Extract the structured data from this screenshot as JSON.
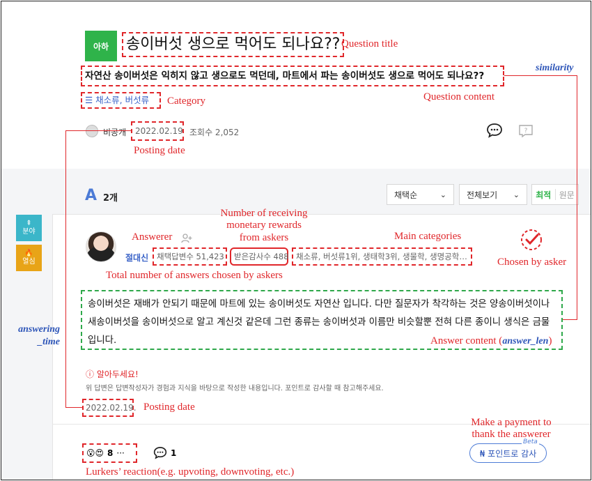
{
  "question": {
    "badge": "아하",
    "title": "송이버섯 생으로 먹어도 되나요??",
    "content": "자연산 송이버섯은 익히지 않고 생으로도 먹던데, 마트에서 파는 송이버섯도 생으로 먹어도 되나요??",
    "category": "☰ 채소류, 버섯류",
    "author": "비공개",
    "date": "2022.02.19",
    "views": "조회수 2,052"
  },
  "answers_header": {
    "count_icon": "A",
    "count": "2개",
    "sort_select": "채택순",
    "view_select": "전체보기",
    "tab_latest": "최적",
    "tab_original": "원문"
  },
  "side_buttons": [
    {
      "icon": "⇞",
      "label": "분야",
      "color": "#3bb6c9"
    },
    {
      "icon": "🔥",
      "label": "열심",
      "color": "#e8a417"
    }
  ],
  "answer": {
    "name": "절대신",
    "chosen_count": "채택답변수 51,423",
    "rewards": "받은감사수 488",
    "main_categories": "채소류, 버섯류1위, 생태학3위, 생물학, 생명공학…",
    "content": "송이버섯은 재배가 안되기 때문에 마트에 있는 송이버섯도 자연산 입니다. 다만 질문자가 착각하는 것은 양송이버섯이나 새송이버섯을 송이버섯으로 알고 계신것 같은데 그런 종류는 송이버섯과 이름만 비슷할뿐 전혀 다른 종이니 생식은 금물입니다.",
    "notice_title": "ⓘ 알아두세요!",
    "notice_body": "위 답변은 답변작성자가 경험과 지식을 바탕으로 작성한 내용입니다. 포인트로 감사할 때 참고해주세요.",
    "date": "2022.02.19.",
    "reaction_emoji": "😮😍",
    "reaction_count": "8",
    "reaction_more": "···",
    "comment_count": "1",
    "pay_button": "₦ 포인트로 감사",
    "pay_beta": "Beta"
  },
  "annotations": {
    "question_title": "Question title",
    "similarity": "similarity",
    "question_content": "Question content",
    "category": "Category",
    "posting_date": "Posting date",
    "answerer": "Answerer",
    "rewards": "Number of receiving monetary rewards from askers",
    "main_categories": "Main categories",
    "chosen_by_asker": "Chosen by asker",
    "total_chosen": "Total number of answers chosen by askers",
    "answering_time": "answering _time",
    "answer_content": "Answer content (",
    "answer_len": "answer_len",
    "answer_content_close": ")",
    "posting_date_2": "Posting date",
    "payment": "Make a payment to thank the answerer",
    "lurkers": "Lurkers’ reaction(e.g. upvoting, downvoting, etc.)"
  },
  "colors": {
    "accent_green": "#2fb34a",
    "annotation_red": "#e0262a",
    "annotation_blue": "#2d55b8"
  }
}
